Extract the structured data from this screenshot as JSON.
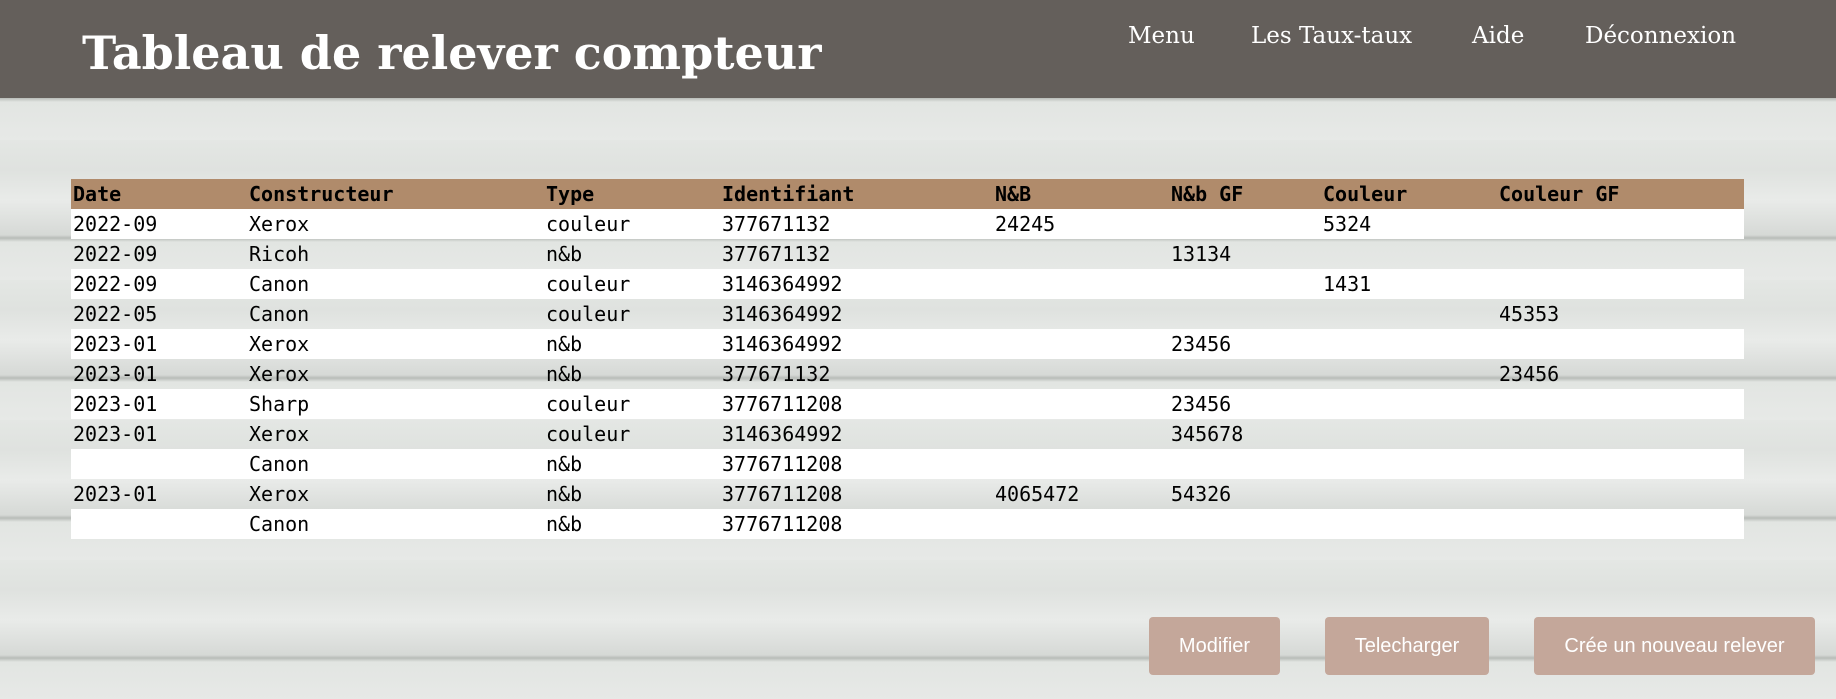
{
  "header": {
    "title": "Tableau de relever compteur",
    "nav": [
      "Menu",
      "Les Taux-taux",
      "Aide",
      "Déconnexion"
    ]
  },
  "table": {
    "columns": [
      "Date",
      "Constructeur",
      "Type",
      "Identifiant",
      "N&B",
      "N&b GF",
      "Couleur",
      "Couleur GF"
    ],
    "rows": [
      [
        "2022-09",
        "Xerox",
        "couleur",
        "377671132",
        "24245",
        "",
        "5324",
        ""
      ],
      [
        "2022-09",
        "Ricoh",
        "n&b",
        "377671132",
        "",
        "13134",
        "",
        ""
      ],
      [
        "2022-09",
        "Canon",
        "couleur",
        "3146364992",
        "",
        "",
        "1431",
        ""
      ],
      [
        "2022-05",
        "Canon",
        "couleur",
        "3146364992",
        "",
        "",
        "",
        "45353"
      ],
      [
        "2023-01",
        "Xerox",
        "n&b",
        "3146364992",
        "",
        "23456",
        "",
        ""
      ],
      [
        "2023-01",
        "Xerox",
        "n&b",
        "377671132",
        "",
        "",
        "",
        "23456"
      ],
      [
        "2023-01",
        "Sharp",
        "couleur",
        "3776711208",
        "",
        "23456",
        "",
        ""
      ],
      [
        "2023-01",
        "Xerox",
        "couleur",
        "3146364992",
        "",
        "345678",
        "",
        ""
      ],
      [
        "",
        "Canon",
        "n&b",
        "3776711208",
        "",
        "",
        "",
        ""
      ],
      [
        "2023-01",
        "Xerox",
        "n&b",
        "3776711208",
        "4065472",
        "54326",
        "",
        ""
      ],
      [
        "",
        "Canon",
        "n&b",
        "3776711208",
        "",
        "",
        "",
        ""
      ]
    ]
  },
  "actions": {
    "modify": "Modifier",
    "download": "Telecharger",
    "create": "Crée un nouveau relever"
  },
  "colors": {
    "header_bg": "#645f5b",
    "table_header_bg": "#b08b6b",
    "button_bg": "#c4a79a"
  }
}
